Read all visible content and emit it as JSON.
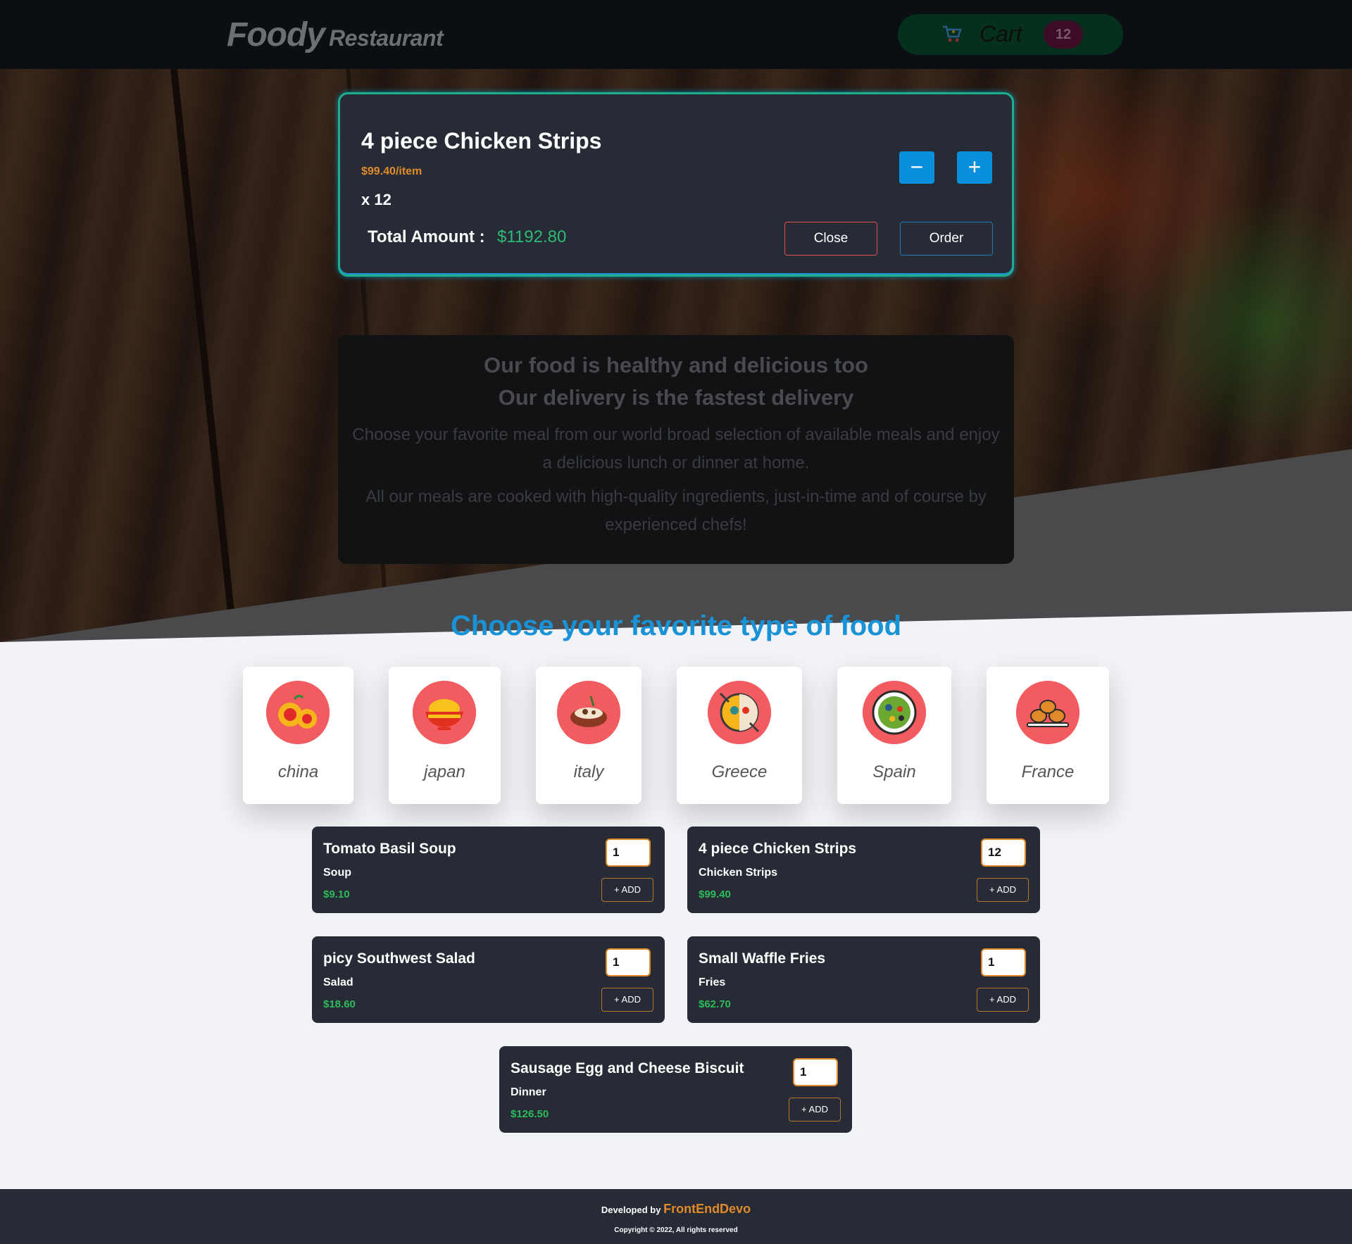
{
  "header": {
    "logo_main": "Foody",
    "logo_sub": "Restaurant",
    "cart_label": "Cart",
    "cart_count": "12"
  },
  "modal": {
    "title": "4 piece Chicken Strips",
    "price": "$99.40/item",
    "quantity": "x 12",
    "total_label": "Total Amount :",
    "total_value": "$1192.80",
    "minus": "−",
    "plus": "+",
    "close_label": "Close",
    "order_label": "Order"
  },
  "info": {
    "heading_1": "Our food is healthy and delicious too",
    "heading_2": "Our delivery is the fastest delivery",
    "paragraph_1": "Choose your favorite meal from our world broad selection of available meals and enjoy a delicious lunch or dinner at home.",
    "paragraph_2": "All our meals are cooked with high-quality ingredients, just-in-time and of course by experienced chefs!"
  },
  "section_title": "Choose your favorite type of food",
  "categories": [
    {
      "name": "china",
      "icon": "oranges-icon"
    },
    {
      "name": "japan",
      "icon": "ramen-bowl-icon"
    },
    {
      "name": "italy",
      "icon": "pasta-dish-icon"
    },
    {
      "name": "Greece",
      "icon": "paella-pan-icon"
    },
    {
      "name": "Spain",
      "icon": "salad-bowl-icon"
    },
    {
      "name": "France",
      "icon": "pastries-icon"
    }
  ],
  "meals": [
    {
      "name": "Tomato Basil Soup",
      "category": "Soup",
      "price": "$9.10",
      "qty": "1",
      "add": "+ ADD"
    },
    {
      "name": "4 piece Chicken Strips",
      "category": "Chicken Strips",
      "price": "$99.40",
      "qty": "12",
      "add": "+ ADD"
    },
    {
      "name": "picy Southwest Salad",
      "category": "Salad",
      "price": "$18.60",
      "qty": "1",
      "add": "+ ADD"
    },
    {
      "name": "Small Waffle Fries",
      "category": "Fries",
      "price": "$62.70",
      "qty": "1",
      "add": "+ ADD"
    },
    {
      "name": "Sausage Egg and Cheese Biscuit",
      "category": "Dinner",
      "price": "$126.50",
      "qty": "1",
      "add": "+ ADD"
    }
  ],
  "footer": {
    "developed_by": "Developed by",
    "developer": "FrontEndDevo",
    "copyright": "Copyright © 2022, All rights reserved"
  },
  "colors": {
    "accent_blue": "#1a92d6",
    "price_green": "#2dbb5a",
    "price_orange": "#e08a2a",
    "card_dark": "#262b35",
    "category_icon_bg": "#f25b60"
  }
}
